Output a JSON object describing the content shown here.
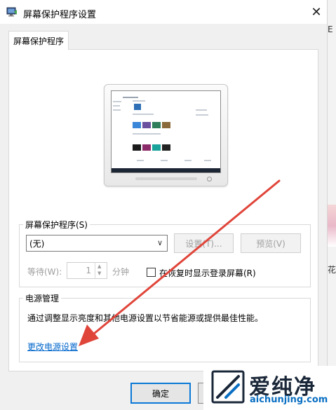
{
  "window": {
    "title": "屏幕保护程序设置",
    "close_glyph": "✕"
  },
  "tab": {
    "label": "屏幕保护程序"
  },
  "screensaver": {
    "group_label": "屏幕保护程序(S)",
    "selected": "(无)",
    "settings_button": "设置(T)...",
    "preview_button": "预览(V)",
    "wait_label": "等待(W):",
    "wait_value": "1",
    "wait_unit": "分钟",
    "logon_checkbox_label": "在恢复时显示登录屏幕(R)",
    "logon_checked": false
  },
  "power": {
    "group_label": "电源管理",
    "description": "通过调整显示亮度和其他电源设置以节省能源或提供最佳性能。",
    "link": "更改电源设置"
  },
  "footer": {
    "ok_button": "确定"
  },
  "background_window": {
    "fragment_top": "E",
    "fragment_bottom": "花"
  },
  "watermark": {
    "cn": "爱纯净",
    "en": "aichunjing.com"
  },
  "colors": {
    "link": "#0066cc",
    "annotation_arrow": "#e0453a",
    "default_button_border": "#0a78d7"
  }
}
